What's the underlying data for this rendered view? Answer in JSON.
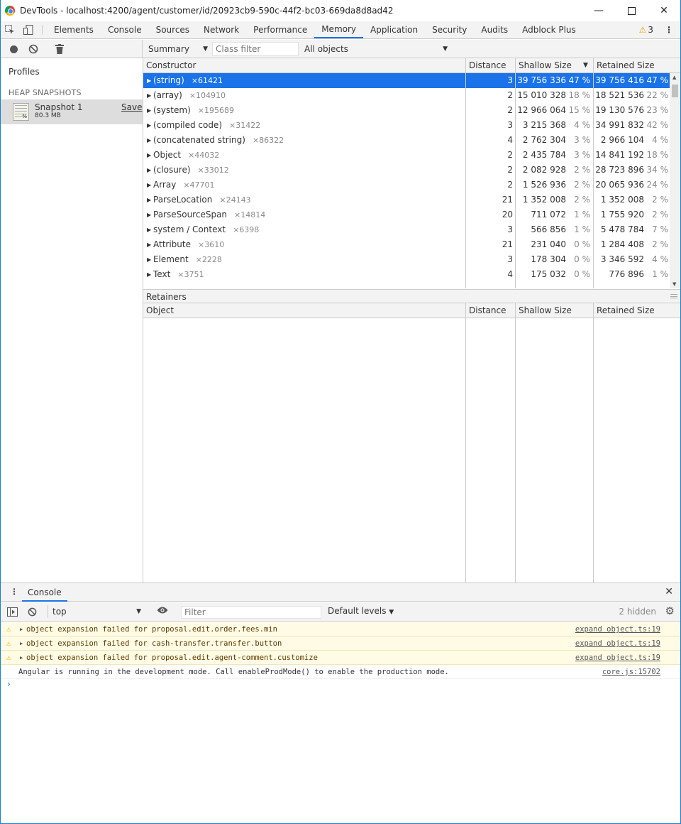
{
  "window": {
    "title": "DevTools - localhost:4200/agent/customer/id/20923cb9-590c-44f2-bc03-669da8d8ad42",
    "controls": [
      "minimize",
      "maximize",
      "close"
    ]
  },
  "tabs": {
    "items": [
      "Elements",
      "Console",
      "Sources",
      "Network",
      "Performance",
      "Memory",
      "Application",
      "Security",
      "Audits",
      "Adblock Plus"
    ],
    "active": "Memory",
    "warning_count": "3"
  },
  "memory_toolbar": {
    "view_select": "Summary",
    "class_filter_placeholder": "Class filter",
    "objects_select": "All objects"
  },
  "sidebar": {
    "profiles_label": "Profiles",
    "section_label": "HEAP SNAPSHOTS",
    "snapshot": {
      "name": "Snapshot 1",
      "size": "80.3 MB",
      "save_label": "Save",
      "icon_badge": "%"
    }
  },
  "grid": {
    "headers": {
      "constructor": "Constructor",
      "distance": "Distance",
      "shallow": "Shallow Size",
      "retained": "Retained Size"
    },
    "rows": [
      {
        "name": "(string)",
        "count": "×61421",
        "distance": "3",
        "shallow": "39 756 336",
        "shallow_pct": "47 %",
        "retained": "39 756 416",
        "retained_pct": "47 %",
        "selected": true
      },
      {
        "name": "(array)",
        "count": "×104910",
        "distance": "2",
        "shallow": "15 010 328",
        "shallow_pct": "18 %",
        "retained": "18 521 536",
        "retained_pct": "22 %"
      },
      {
        "name": "(system)",
        "count": "×195689",
        "distance": "2",
        "shallow": "12 966 064",
        "shallow_pct": "15 %",
        "retained": "19 130 576",
        "retained_pct": "23 %"
      },
      {
        "name": "(compiled code)",
        "count": "×31422",
        "distance": "3",
        "shallow": "3 215 368",
        "shallow_pct": "4 %",
        "retained": "34 991 832",
        "retained_pct": "42 %"
      },
      {
        "name": "(concatenated string)",
        "count": "×86322",
        "distance": "4",
        "shallow": "2 762 304",
        "shallow_pct": "3 %",
        "retained": "2 966 104",
        "retained_pct": "4 %"
      },
      {
        "name": "Object",
        "count": "×44032",
        "distance": "2",
        "shallow": "2 435 784",
        "shallow_pct": "3 %",
        "retained": "14 841 192",
        "retained_pct": "18 %"
      },
      {
        "name": "(closure)",
        "count": "×33012",
        "distance": "2",
        "shallow": "2 082 928",
        "shallow_pct": "2 %",
        "retained": "28 723 896",
        "retained_pct": "34 %"
      },
      {
        "name": "Array",
        "count": "×47701",
        "distance": "2",
        "shallow": "1 526 936",
        "shallow_pct": "2 %",
        "retained": "20 065 936",
        "retained_pct": "24 %"
      },
      {
        "name": "ParseLocation",
        "count": "×24143",
        "distance": "21",
        "shallow": "1 352 008",
        "shallow_pct": "2 %",
        "retained": "1 352 008",
        "retained_pct": "2 %"
      },
      {
        "name": "ParseSourceSpan",
        "count": "×14814",
        "distance": "20",
        "shallow": "711 072",
        "shallow_pct": "1 %",
        "retained": "1 755 920",
        "retained_pct": "2 %"
      },
      {
        "name": "system / Context",
        "count": "×6398",
        "distance": "3",
        "shallow": "566 856",
        "shallow_pct": "1 %",
        "retained": "5 478 784",
        "retained_pct": "7 %"
      },
      {
        "name": "Attribute",
        "count": "×3610",
        "distance": "21",
        "shallow": "231 040",
        "shallow_pct": "0 %",
        "retained": "1 284 408",
        "retained_pct": "2 %"
      },
      {
        "name": "Element",
        "count": "×2228",
        "distance": "3",
        "shallow": "178 304",
        "shallow_pct": "0 %",
        "retained": "3 346 592",
        "retained_pct": "4 %"
      },
      {
        "name": "Text",
        "count": "×3751",
        "distance": "4",
        "shallow": "175 032",
        "shallow_pct": "0 %",
        "retained": "776 896",
        "retained_pct": "1 %"
      }
    ]
  },
  "retainers": {
    "title": "Retainers",
    "headers": {
      "object": "Object",
      "distance": "Distance",
      "shallow": "Shallow Size",
      "retained": "Retained Size"
    }
  },
  "console": {
    "tab_label": "Console",
    "context": "top",
    "filter_placeholder": "Filter",
    "levels": "Default levels",
    "hidden": "2 hidden",
    "messages": [
      {
        "type": "warn",
        "text": "object expansion failed for proposal.edit.order.fees.min",
        "source": "expand object.ts:19"
      },
      {
        "type": "warn",
        "text": "object expansion failed for cash-transfer.transfer.button",
        "source": "expand object.ts:19"
      },
      {
        "type": "warn",
        "text": "object expansion failed for proposal.edit.agent-comment.customize",
        "source": "expand object.ts:19"
      },
      {
        "type": "info",
        "text": "Angular is running in the development mode. Call enableProdMode() to enable the production mode.",
        "source": "core.js:15702"
      }
    ],
    "prompt": "›"
  }
}
